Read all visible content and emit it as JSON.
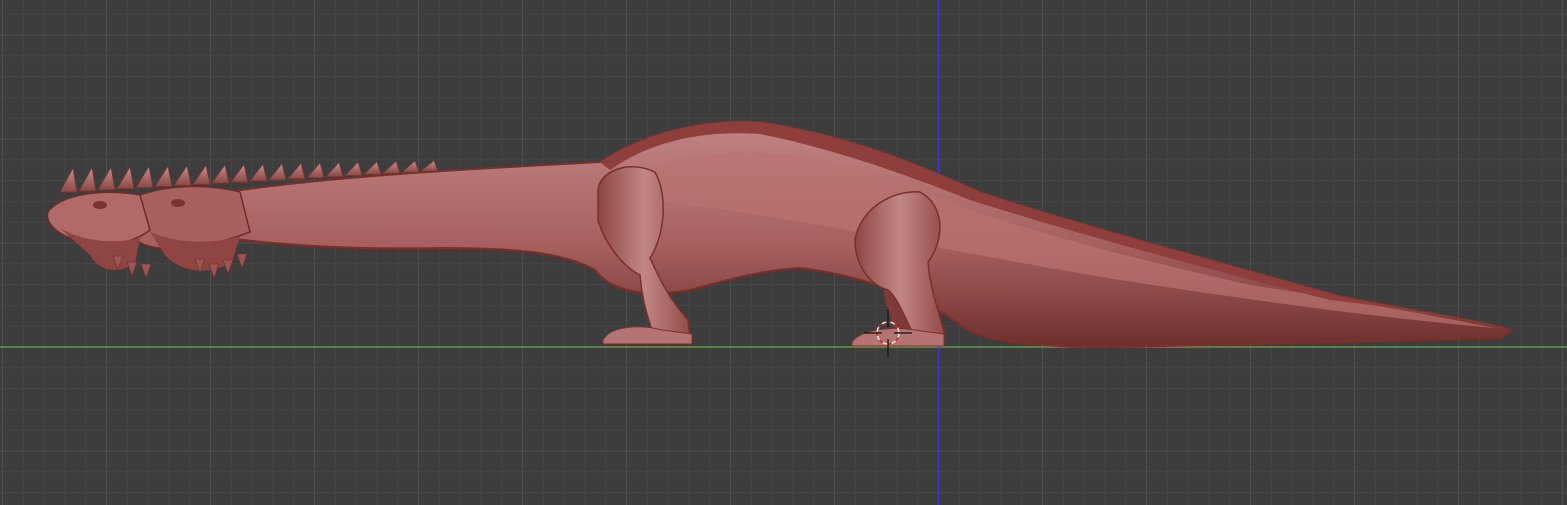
{
  "viewport": {
    "background_color": "#3d3d3d",
    "grid_minor_color": "#474747",
    "grid_major_color": "#505050",
    "x_axis_color": "#6aa84f",
    "z_axis_color": "#3b3bd6"
  },
  "model": {
    "base_color": "#a45a58",
    "light_color": "#c98a88",
    "shadow_color": "#5a2523",
    "outline_color": "#7a2f2b"
  },
  "cursor": {
    "icon": "3d-cursor-icon"
  }
}
